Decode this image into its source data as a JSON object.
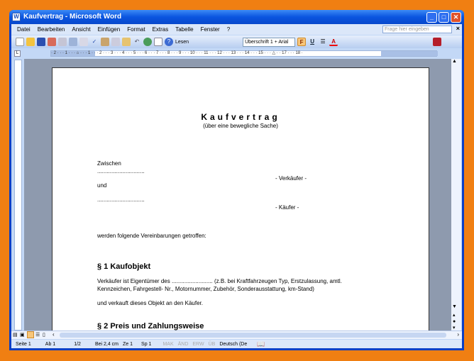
{
  "window": {
    "title": "Kaufvertrag - Microsoft Word"
  },
  "menu": [
    "Datei",
    "Bearbeiten",
    "Ansicht",
    "Einfügen",
    "Format",
    "Extras",
    "Tabelle",
    "Fenster",
    "?"
  ],
  "help_box": {
    "placeholder": "Frage hier eingeben"
  },
  "toolbar": {
    "read_label": "Lesen",
    "style_value": "Überschrift 1 + Arial",
    "bold": "F",
    "underline": "U"
  },
  "ruler": {
    "marks": "· 2 · · · 1 · · · ⌂ · · · 1 · · · 2 · · · 3 · · · 4 · · · 5 · · · 6 · · · 7 · · · 8 · · · 9 · · · 10 · · · 11 · · · 12 · · · 13 · · · 14 · · · 15 · · · △ · · 17 · · · 18 ·"
  },
  "document": {
    "title": "Kaufvertrag",
    "subtitle": "(über eine bewegliche Sache)",
    "zwischen": "Zwischen",
    "dots1": "..............................",
    "seller_role": "-   Verkäufer   -",
    "und": "und",
    "dots2": "..............................",
    "buyer_role": "-   Käufer   -",
    "agreement": "werden folgende Vereinbarungen getroffen:",
    "s1_heading": "§ 1 Kaufobjekt",
    "s1_line1": "Verkäufer ist Eigentümer des .......................... (z.B. bei Kraftfahrzeugen Typ, Erstzulassung, amtl.",
    "s1_line2": "Kennzeichen, Fahrgestell- Nr., Motornummer, Zubehör, Sonderausstattung, km-Stand)",
    "s1_line3": "und verkauft dieses Objekt an den Käufer.",
    "s2_heading": "§ 2 Preis und Zahlungsweise"
  },
  "status": {
    "page": "Seite 1",
    "section": "Ab 1",
    "pages": "1/2",
    "position": "Bei 2,4 cm",
    "line": "Ze 1",
    "column": "Sp 1",
    "mak": "MAK",
    "aend": "ÄND",
    "erw": "ERW",
    "ub": "ÜB",
    "language": "Deutsch (De"
  }
}
